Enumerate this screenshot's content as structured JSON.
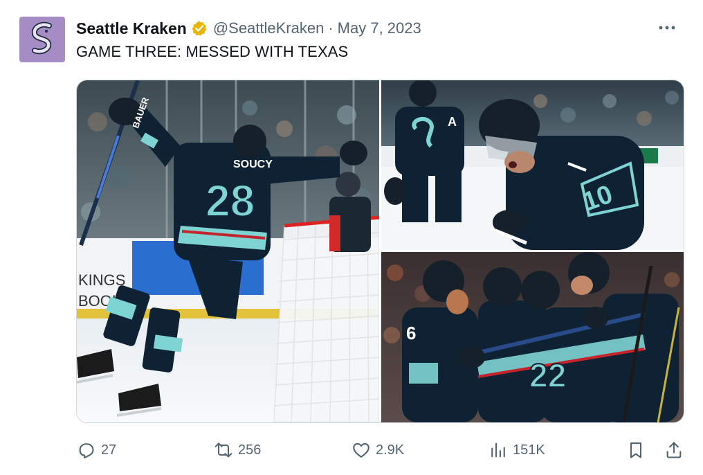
{
  "author": {
    "name": "Seattle Kraken",
    "handle": "@SeattleKraken",
    "separator": "·",
    "date": "May 7, 2023",
    "avatar_icon": "kraken-logo-icon",
    "verified_icon": "verified-gold-badge-icon",
    "colors": {
      "avatar_bg": "#a58cc4",
      "verified": "#e8b400"
    }
  },
  "tweet": {
    "text": "GAME THREE: MESSED WITH TEXAS",
    "more_icon": "more-options-icon"
  },
  "media": {
    "photos": [
      {
        "position": "left",
        "jersey_name": "SOUCY",
        "jersey_number": "28",
        "stick_brand": "BAUER",
        "board_text": "KINGS BOOK"
      },
      {
        "position": "top-right",
        "jersey_number": "10",
        "captain_letter": "A"
      },
      {
        "position": "bottom-right",
        "jersey_number": "22",
        "number_left": "6"
      }
    ]
  },
  "actions": {
    "reply": {
      "icon": "reply-icon",
      "count": "27"
    },
    "retweet": {
      "icon": "retweet-icon",
      "count": "256"
    },
    "like": {
      "icon": "heart-icon",
      "count": "2.9K"
    },
    "views": {
      "icon": "views-chart-icon",
      "count": "151K"
    },
    "bookmark": {
      "icon": "bookmark-icon"
    },
    "share": {
      "icon": "share-icon"
    }
  }
}
